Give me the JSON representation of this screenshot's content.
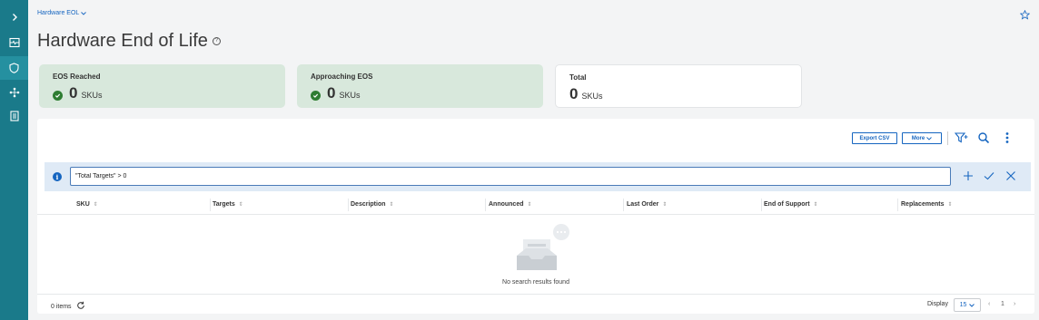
{
  "breadcrumb": {
    "label": "Hardware EOL"
  },
  "page": {
    "title": "Hardware End of Life"
  },
  "cards": [
    {
      "label": "EOS Reached",
      "value": "0",
      "unit": "SKUs",
      "status": "ok"
    },
    {
      "label": "Approaching EOS",
      "value": "0",
      "unit": "SKUs",
      "status": "ok"
    },
    {
      "label": "Total",
      "value": "0",
      "unit": "SKUs"
    }
  ],
  "toolbar": {
    "export_label": "Export CSV",
    "more_label": "More"
  },
  "filter": {
    "value": "\"Total Targets\" > 0"
  },
  "table": {
    "columns": [
      "SKU",
      "Targets",
      "Description",
      "Announced",
      "Last Order",
      "End of Support",
      "Replacements"
    ],
    "rows": [],
    "empty_text": "No search results found"
  },
  "footer": {
    "items_text": "0 items",
    "display_label": "Display",
    "page_size": "15",
    "page_number": "1"
  },
  "colors": {
    "sidebar": "#1a7a8a",
    "accent": "#1565c0",
    "card_green": "#d8e8dc",
    "ok": "#2e7d32"
  },
  "icons": {
    "sidebar": [
      "chevron-right-icon",
      "dashboard-icon",
      "shield-icon",
      "network-icon",
      "report-icon"
    ],
    "toolbar": [
      "filter-icon",
      "search-icon",
      "kebab-menu-icon"
    ],
    "filterbar": [
      "info-icon",
      "add-icon",
      "check-icon",
      "close-icon"
    ]
  }
}
